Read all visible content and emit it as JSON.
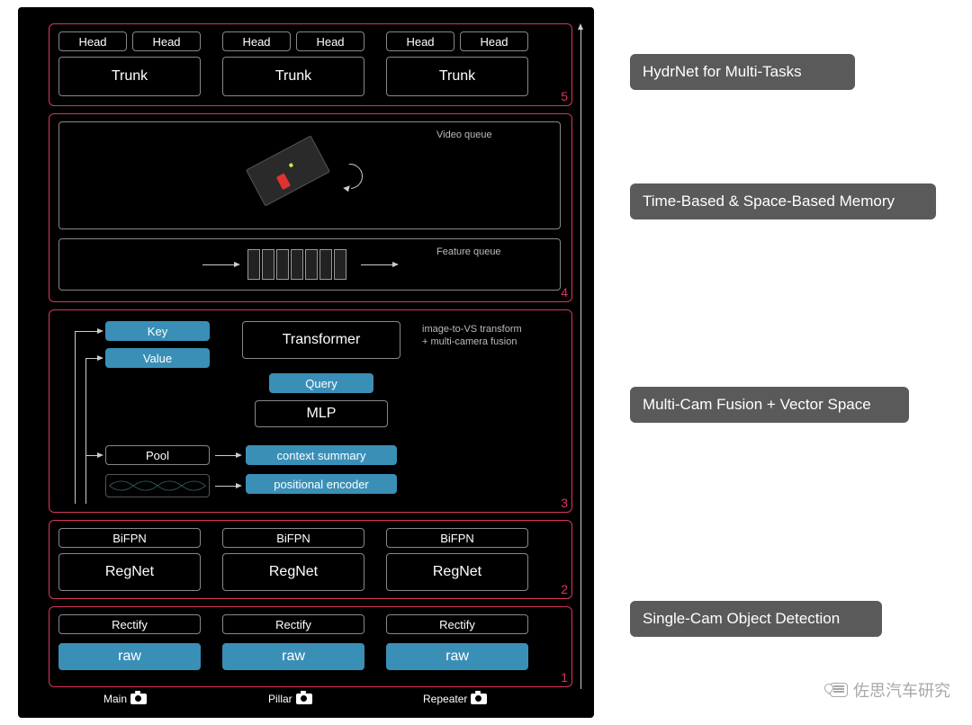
{
  "stages": {
    "s1": {
      "num": "1",
      "columns": [
        {
          "rectify": "Rectify",
          "raw": "raw",
          "cam": "Main"
        },
        {
          "rectify": "Rectify",
          "raw": "raw",
          "cam": "Pillar"
        },
        {
          "rectify": "Rectify",
          "raw": "raw",
          "cam": "Repeater"
        }
      ]
    },
    "s2": {
      "num": "2",
      "columns": [
        {
          "bifpn": "BiFPN",
          "regnet": "RegNet"
        },
        {
          "bifpn": "BiFPN",
          "regnet": "RegNet"
        },
        {
          "bifpn": "BiFPN",
          "regnet": "RegNet"
        }
      ]
    },
    "s3": {
      "num": "3",
      "key": "Key",
      "value": "Value",
      "pool": "Pool",
      "transformer": "Transformer",
      "query": "Query",
      "mlp": "MLP",
      "context": "context summary",
      "posenc": "positional encoder",
      "caption": "image-to-VS transform\n+ multi-camera fusion"
    },
    "s4": {
      "num": "4",
      "video_label": "Video queue",
      "feature_label": "Feature queue"
    },
    "s5": {
      "num": "5",
      "columns": [
        {
          "headA": "Head",
          "headB": "Head",
          "trunk": "Trunk"
        },
        {
          "headA": "Head",
          "headB": "Head",
          "trunk": "Trunk"
        },
        {
          "headA": "Head",
          "headB": "Head",
          "trunk": "Trunk"
        }
      ]
    }
  },
  "labels": {
    "l5": "HydrNet for Multi-Tasks",
    "l4": "Time-Based & Space-Based Memory",
    "l3": "Multi-Cam Fusion + Vector Space",
    "l12": "Single-Cam Object Detection"
  },
  "watermark": "佐思汽车研究"
}
